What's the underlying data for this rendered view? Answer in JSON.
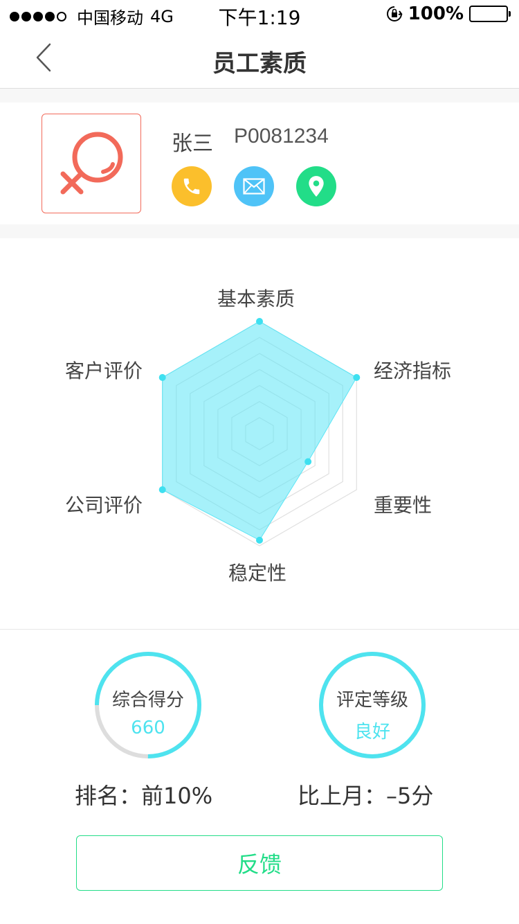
{
  "status_bar": {
    "carrier": "中国移动",
    "network": "4G",
    "time": "下午1:19",
    "battery": "100%"
  },
  "nav": {
    "title": "员工素质",
    "back_icon": "chevron-left-icon"
  },
  "profile": {
    "name": "张三",
    "employee_id": "P0081234",
    "avatar_icon": "female-symbol-icon",
    "contacts": [
      {
        "icon": "phone-icon",
        "color": "#fbbf2c"
      },
      {
        "icon": "mail-icon",
        "color": "#4fc3f7"
      },
      {
        "icon": "location-icon",
        "color": "#22dd88"
      }
    ]
  },
  "radar": {
    "labels": [
      "基本素质",
      "经济指标",
      "重要性",
      "稳定性",
      "公司评价",
      "客户评价"
    ],
    "values": [
      1.0,
      1.0,
      0.5,
      0.95,
      1.0,
      1.0
    ],
    "fill_color": "#5ce5f5",
    "point_color": "#3ee0f0",
    "grid_color": "#e0e0e0"
  },
  "score": {
    "title": "综合得分",
    "value": "660",
    "progress": 0.75,
    "rank_text": "排名：前10%"
  },
  "grade": {
    "title": "评定等级",
    "value": "良好",
    "progress": 1.0,
    "change_text": "比上月：–5分"
  },
  "feedback_label": "反馈",
  "colors": {
    "accent_cyan": "#4ee3ef",
    "accent_green": "#22dd88",
    "avatar_red": "#f26a5a"
  }
}
